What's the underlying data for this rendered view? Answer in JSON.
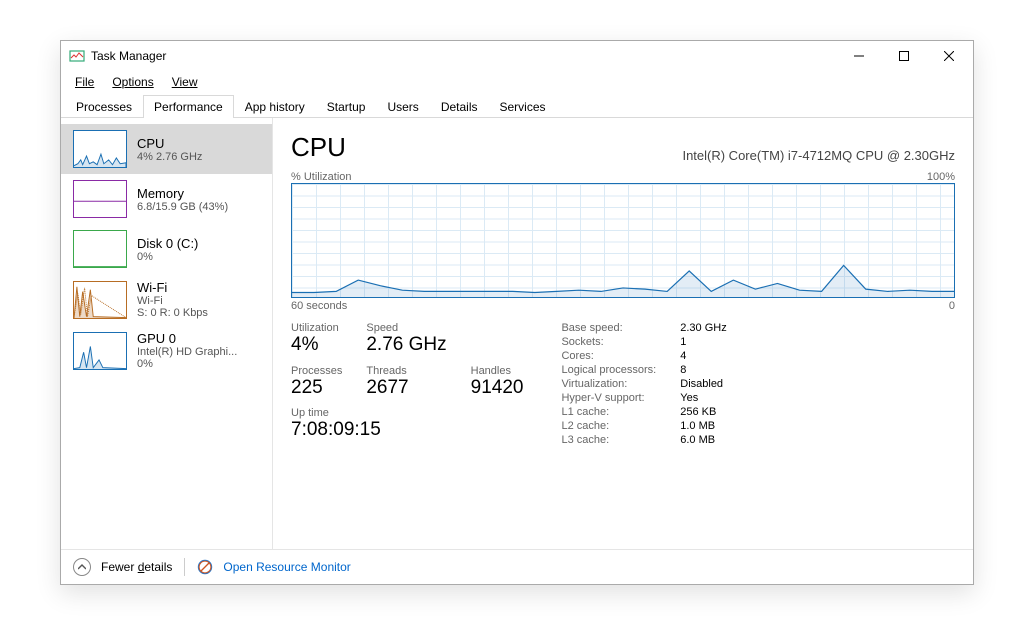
{
  "window": {
    "title": "Task Manager"
  },
  "menu": {
    "file": "File",
    "options": "Options",
    "view": "View"
  },
  "tabs": {
    "processes": "Processes",
    "performance": "Performance",
    "app_history": "App history",
    "startup": "Startup",
    "users": "Users",
    "details": "Details",
    "services": "Services"
  },
  "sidebar": {
    "cpu": {
      "name": "CPU",
      "sub1": "4% 2.76 GHz"
    },
    "memory": {
      "name": "Memory",
      "sub1": "6.8/15.9 GB (43%)"
    },
    "disk": {
      "name": "Disk 0 (C:)",
      "sub1": "0%"
    },
    "wifi": {
      "name": "Wi-Fi",
      "sub1": "Wi-Fi",
      "sub2": "S: 0 R: 0 Kbps"
    },
    "gpu": {
      "name": "GPU 0",
      "sub1": "Intel(R) HD Graphi...",
      "sub2": "0%"
    }
  },
  "main_title": "CPU",
  "cpu_name": "Intel(R) Core(TM) i7-4712MQ CPU @ 2.30GHz",
  "chart_label_left": "% Utilization",
  "chart_label_right": "100%",
  "chart_foot_left": "60 seconds",
  "chart_foot_right": "0",
  "stats": {
    "utilization_label": "Utilization",
    "utilization": "4%",
    "speed_label": "Speed",
    "speed": "2.76 GHz",
    "processes_label": "Processes",
    "processes": "225",
    "threads_label": "Threads",
    "threads": "2677",
    "handles_label": "Handles",
    "handles": "91420",
    "uptime_label": "Up time",
    "uptime": "7:08:09:15"
  },
  "specs": {
    "base_speed_k": "Base speed:",
    "base_speed_v": "2.30 GHz",
    "sockets_k": "Sockets:",
    "sockets_v": "1",
    "cores_k": "Cores:",
    "cores_v": "4",
    "logical_k": "Logical processors:",
    "logical_v": "8",
    "virt_k": "Virtualization:",
    "virt_v": "Disabled",
    "hyperv_k": "Hyper-V support:",
    "hyperv_v": "Yes",
    "l1_k": "L1 cache:",
    "l1_v": "256 KB",
    "l2_k": "L2 cache:",
    "l2_v": "1.0 MB",
    "l3_k": "L3 cache:",
    "l3_v": "6.0 MB"
  },
  "footer": {
    "fewer_prefix": "Fewer ",
    "fewer_ul": "d",
    "fewer_suffix": "etails",
    "open_rm": "Open Resource Monitor"
  },
  "chart_data": {
    "type": "line",
    "title": "% Utilization",
    "xlabel": "60 seconds → 0",
    "ylabel": "% Utilization",
    "ylim": [
      0,
      100
    ],
    "x_seconds_ago": [
      60,
      58,
      56,
      54,
      52,
      50,
      48,
      46,
      44,
      42,
      40,
      38,
      36,
      34,
      32,
      30,
      28,
      26,
      24,
      22,
      20,
      18,
      16,
      14,
      12,
      10,
      8,
      6,
      4,
      2,
      0
    ],
    "values": [
      4,
      4,
      5,
      15,
      10,
      6,
      5,
      5,
      5,
      5,
      5,
      4,
      5,
      6,
      5,
      8,
      7,
      5,
      23,
      5,
      15,
      7,
      12,
      6,
      5,
      28,
      7,
      5,
      6,
      5,
      5
    ]
  }
}
